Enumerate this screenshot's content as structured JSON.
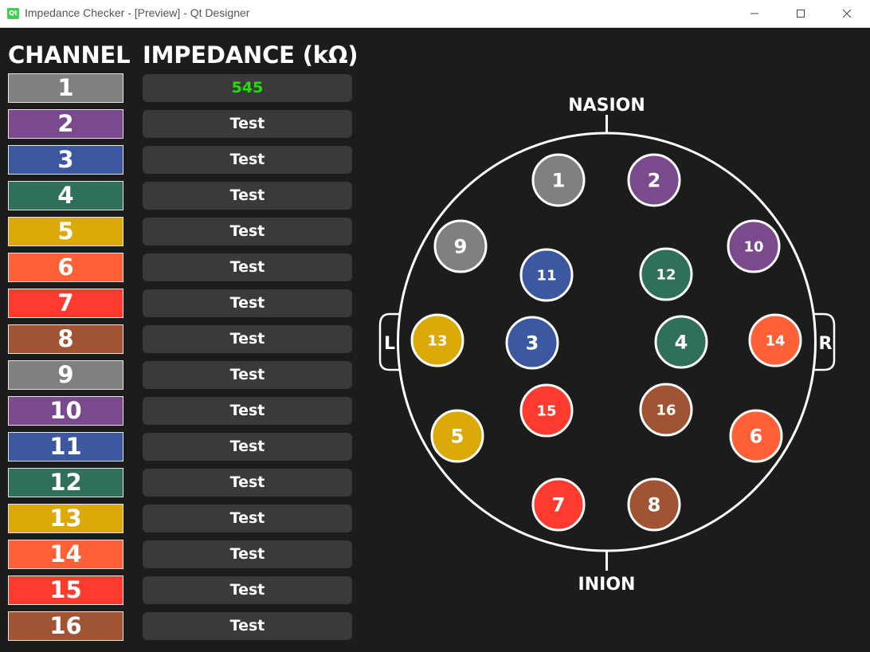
{
  "window": {
    "title": "Impedance Checker - [Preview] - Qt Designer",
    "app_icon_text": "Qt"
  },
  "headers": {
    "channel": "CHANNEL",
    "impedance": "IMPEDANCE (kΩ)"
  },
  "channels": [
    {
      "label": "1",
      "color": "#808080",
      "impedance": "545",
      "impedance_color": "#22e000"
    },
    {
      "label": "2",
      "color": "#7b4a8c",
      "impedance": "Test",
      "impedance_color": "#ffffff"
    },
    {
      "label": "3",
      "color": "#3b58a0",
      "impedance": "Test",
      "impedance_color": "#ffffff"
    },
    {
      "label": "4",
      "color": "#30705a",
      "impedance": "Test",
      "impedance_color": "#ffffff"
    },
    {
      "label": "5",
      "color": "#dbaa08",
      "impedance": "Test",
      "impedance_color": "#ffffff"
    },
    {
      "label": "6",
      "color": "#ff6136",
      "impedance": "Test",
      "impedance_color": "#ffffff"
    },
    {
      "label": "7",
      "color": "#ff3b2f",
      "impedance": "Test",
      "impedance_color": "#ffffff"
    },
    {
      "label": "8",
      "color": "#a05434",
      "impedance": "Test",
      "impedance_color": "#ffffff"
    },
    {
      "label": "9",
      "color": "#808080",
      "impedance": "Test",
      "impedance_color": "#ffffff"
    },
    {
      "label": "10",
      "color": "#7b4a8c",
      "impedance": "Test",
      "impedance_color": "#ffffff"
    },
    {
      "label": "11",
      "color": "#3b58a0",
      "impedance": "Test",
      "impedance_color": "#ffffff"
    },
    {
      "label": "12",
      "color": "#30705a",
      "impedance": "Test",
      "impedance_color": "#ffffff"
    },
    {
      "label": "13",
      "color": "#dbaa08",
      "impedance": "Test",
      "impedance_color": "#ffffff"
    },
    {
      "label": "14",
      "color": "#ff6136",
      "impedance": "Test",
      "impedance_color": "#ffffff"
    },
    {
      "label": "15",
      "color": "#ff3b2f",
      "impedance": "Test",
      "impedance_color": "#ffffff"
    },
    {
      "label": "16",
      "color": "#a05434",
      "impedance": "Test",
      "impedance_color": "#ffffff"
    }
  ],
  "head_map": {
    "nasion_label": "NASION",
    "inion_label": "INION",
    "left_label": "L",
    "right_label": "R"
  },
  "icons": {
    "minimize": "minimize-icon",
    "maximize": "maximize-icon",
    "close": "close-icon"
  }
}
